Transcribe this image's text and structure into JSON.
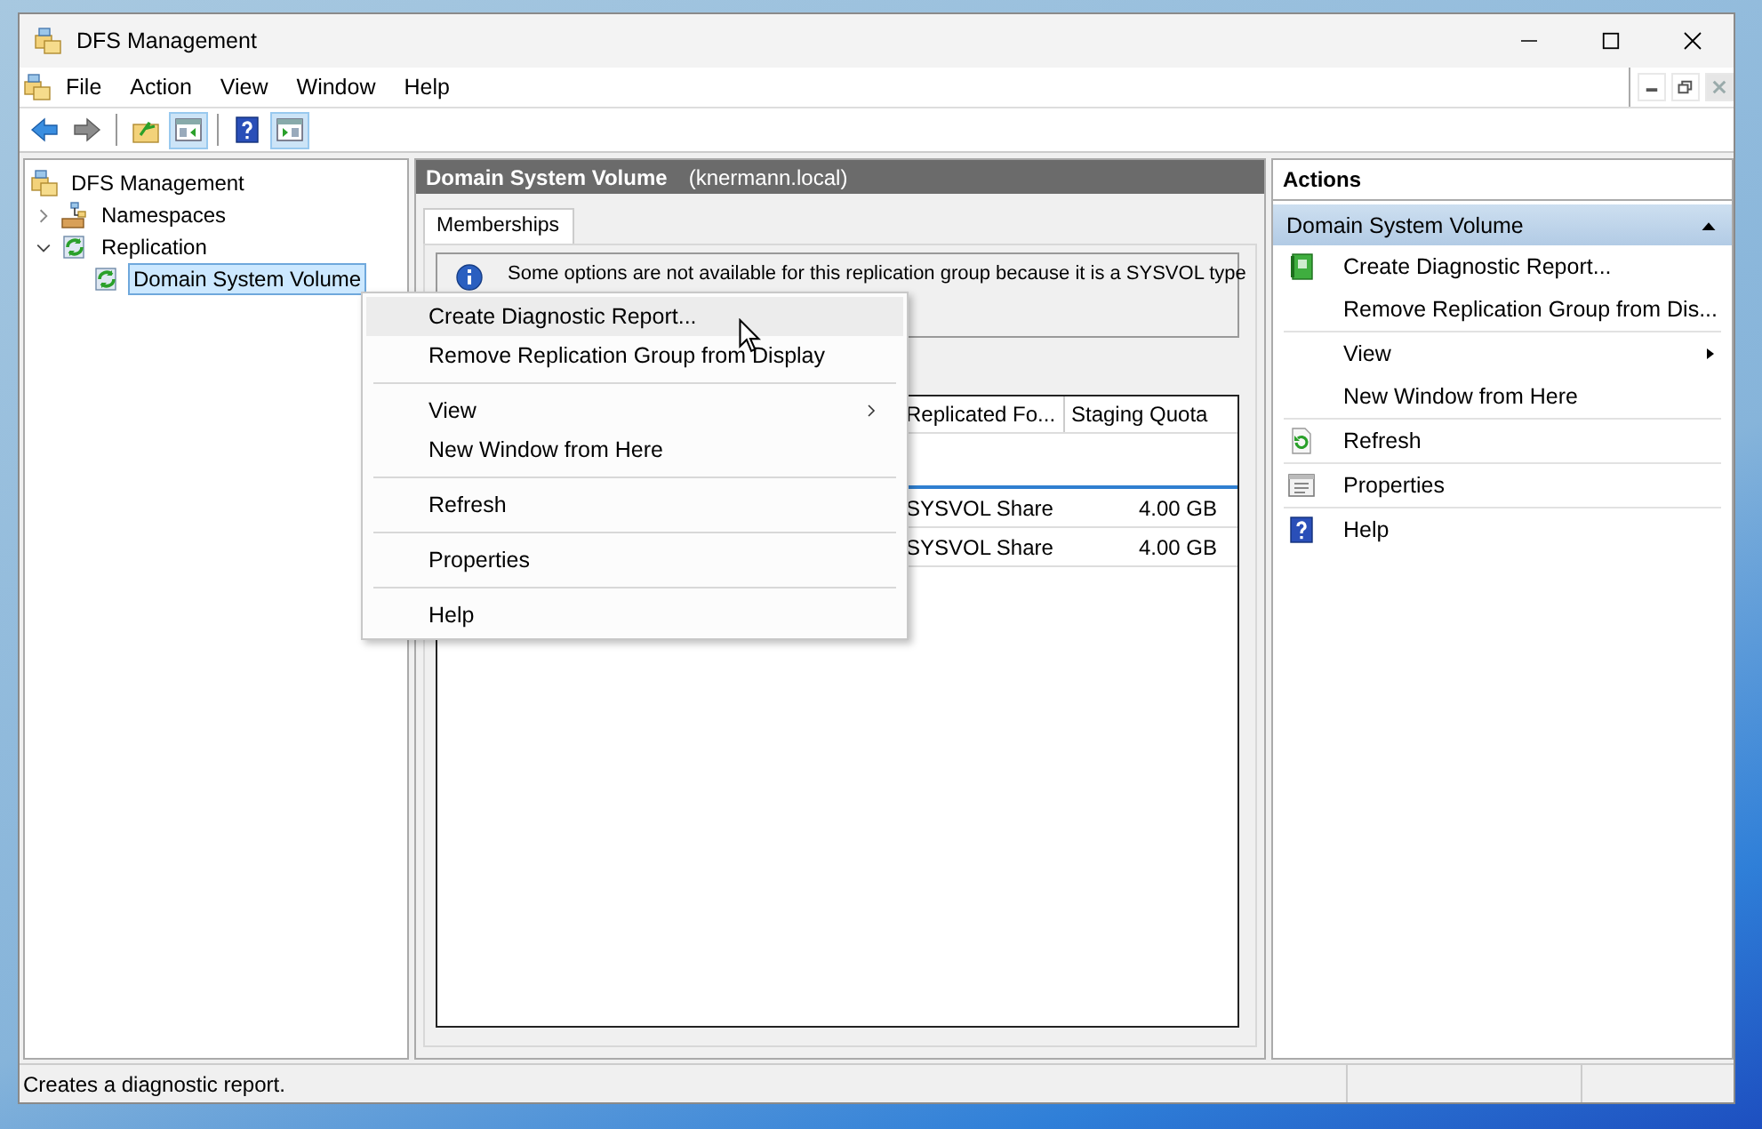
{
  "window": {
    "title": "DFS Management"
  },
  "menu_bar": [
    "File",
    "Action",
    "View",
    "Window",
    "Help"
  ],
  "tree": [
    {
      "label": "DFS Management",
      "kind": "root",
      "selected": false,
      "children": [
        {
          "label": "Namespaces",
          "kind": "namespaces",
          "expanded": false,
          "selected": false
        },
        {
          "label": "Replication",
          "kind": "replication",
          "expanded": true,
          "selected": false,
          "children": [
            {
              "label": "Domain System Volume",
              "kind": "group",
              "selected": true
            }
          ]
        }
      ]
    }
  ],
  "details": {
    "title": "Domain System Volume",
    "domain": "(knermann.local)",
    "tabs": [
      {
        "label": "Memberships",
        "selected": true
      }
    ],
    "info": "Some options are not available for this replication group because it is a SYSVOL type",
    "table": {
      "columns": [
        "Replicated Fo...",
        "Staging Quota"
      ],
      "rows": [
        [
          "SYSVOL Share",
          "4.00 GB"
        ],
        [
          "SYSVOL Share",
          "4.00 GB"
        ]
      ]
    }
  },
  "context_menu": [
    {
      "kind": "item",
      "label": "Create Diagnostic Report...",
      "highlighted": true,
      "submenu": false
    },
    {
      "kind": "item",
      "label": "Remove Replication Group from Display",
      "highlighted": false,
      "submenu": false
    },
    {
      "kind": "separator"
    },
    {
      "kind": "item",
      "label": "View",
      "highlighted": false,
      "submenu": true
    },
    {
      "kind": "item",
      "label": "New Window from Here",
      "highlighted": false,
      "submenu": false
    },
    {
      "kind": "separator"
    },
    {
      "kind": "item",
      "label": "Refresh",
      "highlighted": false,
      "submenu": false
    },
    {
      "kind": "separator"
    },
    {
      "kind": "item",
      "label": "Properties",
      "highlighted": false,
      "submenu": false
    },
    {
      "kind": "separator"
    },
    {
      "kind": "item",
      "label": "Help",
      "highlighted": false,
      "submenu": false
    }
  ],
  "actions": {
    "title": "Actions",
    "section": {
      "label": "Domain System Volume",
      "expanded": true
    },
    "items": [
      {
        "kind": "report",
        "label": "Create Diagnostic Report...",
        "submenu": false
      },
      {
        "kind": "plain",
        "label": "Remove Replication Group from Dis...",
        "submenu": false
      },
      {
        "kind": "separator"
      },
      {
        "kind": "plain",
        "label": "View",
        "submenu": true
      },
      {
        "kind": "plain",
        "label": "New Window from Here",
        "submenu": false
      },
      {
        "kind": "separator"
      },
      {
        "kind": "refresh",
        "label": "Refresh",
        "submenu": false
      },
      {
        "kind": "separator"
      },
      {
        "kind": "properties",
        "label": "Properties",
        "submenu": false
      },
      {
        "kind": "separator"
      },
      {
        "kind": "help",
        "label": "Help",
        "submenu": false
      }
    ]
  },
  "status_bar": {
    "text": "Creates a diagnostic report."
  }
}
